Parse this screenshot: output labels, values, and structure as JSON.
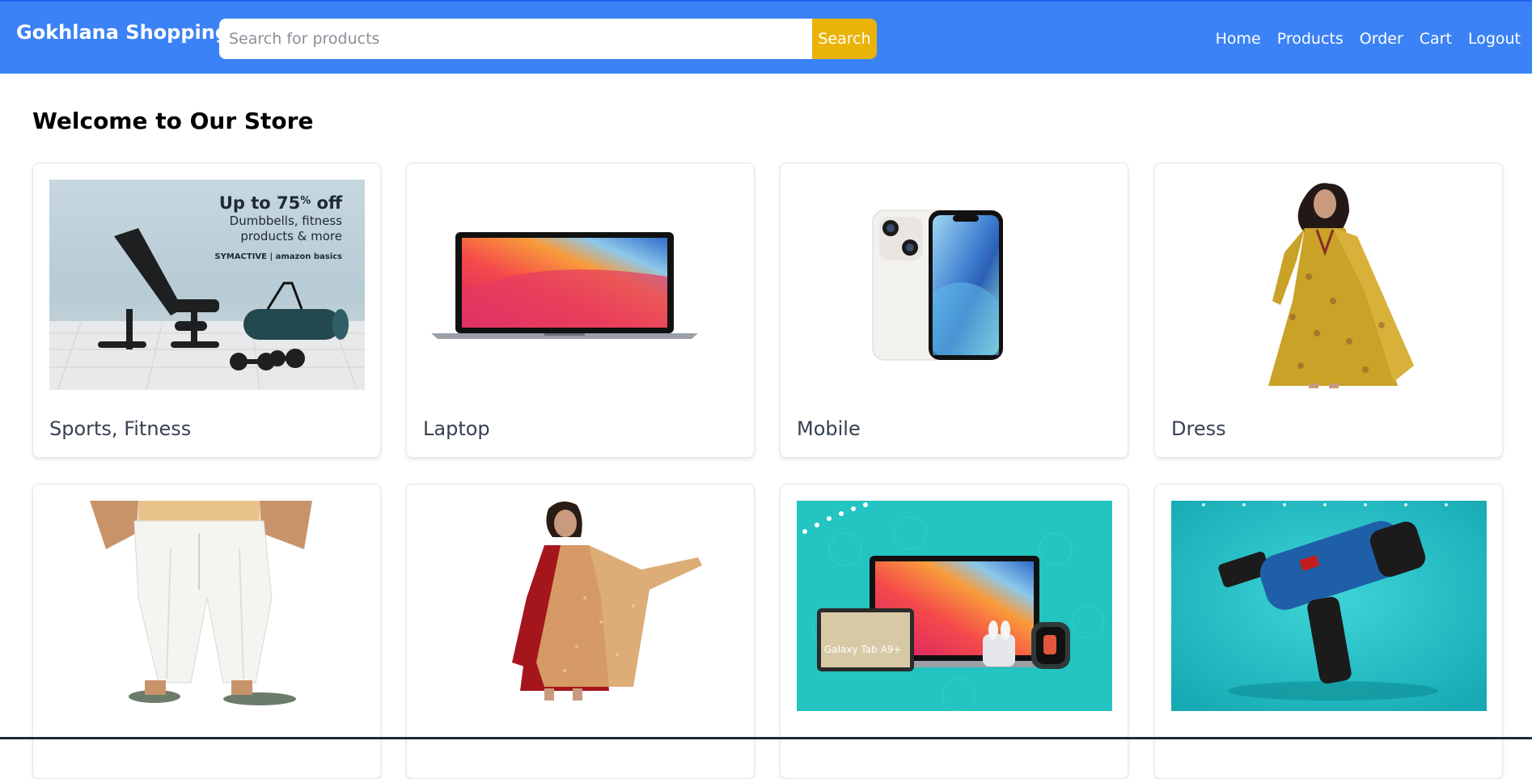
{
  "header": {
    "brand": "Gokhlana Shopping",
    "search_placeholder": "Search for products",
    "search_value": "",
    "search_button": "Search",
    "nav": [
      "Home",
      "Products",
      "Order",
      "Cart",
      "Logout"
    ]
  },
  "main": {
    "title": "Welcome to Our Store",
    "categories": [
      {
        "label": "Sports, Fitness",
        "image": "fitness-banner-image",
        "banner": {
          "headline": "Up to 75",
          "headline_suffix": "% off",
          "line1": "Dumbbells, fitness",
          "line2": "products & more",
          "brands": "SYMACTIVE | amazon basics"
        }
      },
      {
        "label": "Laptop",
        "image": "laptop-image"
      },
      {
        "label": "Mobile",
        "image": "phone-image"
      },
      {
        "label": "Dress",
        "image": "dress-image"
      },
      {
        "label": "",
        "image": "trousers-image"
      },
      {
        "label": "",
        "image": "kurta-dupatta-image"
      },
      {
        "label": "",
        "image": "electronics-banner-image",
        "banner": {
          "tablet_text": "Galaxy Tab A9+"
        }
      },
      {
        "label": "",
        "image": "power-drill-image"
      }
    ]
  },
  "colors": {
    "navbar": "#3b82f6",
    "search_button": "#eab308",
    "card_label": "#374151"
  }
}
